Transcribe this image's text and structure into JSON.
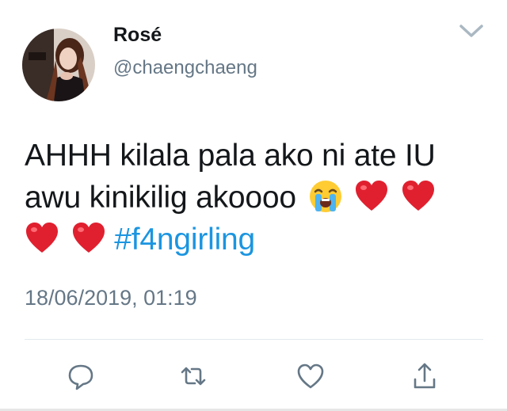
{
  "user": {
    "display_name": "Rosé",
    "handle": "@chaengchaeng"
  },
  "tweet": {
    "line1": "AHHH kilala pala ako ni ate IU",
    "line2_text": "awu kinikilig akoooo",
    "hashtag": "#f4ngirling",
    "timestamp": "18/06/2019, 01:19"
  },
  "icons": {
    "caret": "chevron-down-icon",
    "crying_emoji": "loudly-crying-face-emoji",
    "heart_emoji": "red-heart-emoji",
    "reply": "reply-icon",
    "retweet": "retweet-icon",
    "like": "heart-icon",
    "share": "share-icon"
  },
  "colors": {
    "text": "#14171a",
    "secondary": "#657786",
    "link": "#1b95e0",
    "heart": "#e0202f"
  }
}
